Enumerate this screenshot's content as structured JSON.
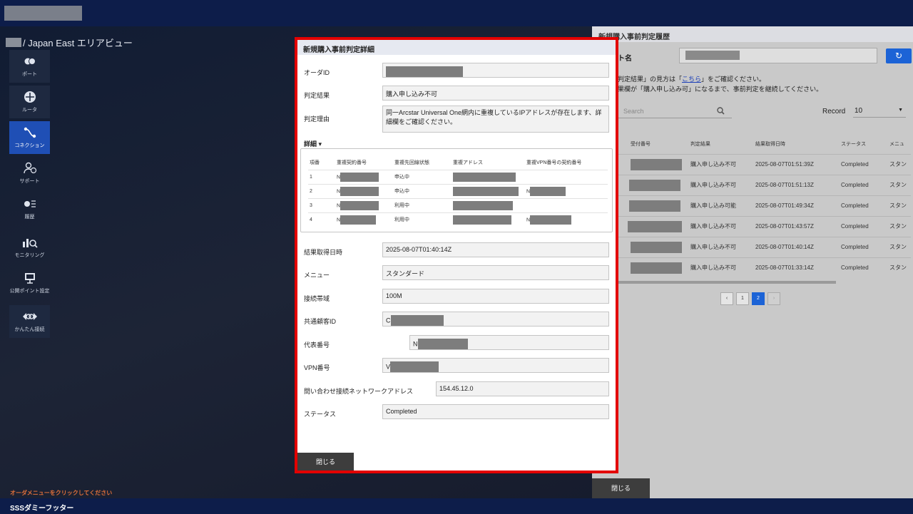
{
  "breadcrumb": {
    "text": "/ Japan East エリアビュー"
  },
  "sidenav": [
    {
      "label": "ポート",
      "icon": "port-icon"
    },
    {
      "label": "ルータ",
      "icon": "router-icon"
    },
    {
      "label": "コネクション",
      "icon": "connection-icon",
      "active": true
    },
    {
      "label": "サポート",
      "icon": "support-icon"
    },
    {
      "label": "履歴",
      "icon": "history-icon"
    },
    {
      "label": "モニタリング",
      "icon": "monitoring-icon"
    },
    {
      "label": "公開ポイント設定",
      "icon": "public-point-icon"
    },
    {
      "label": "かんたん接続",
      "icon": "easy-connect-icon"
    }
  ],
  "hint": "オーダメニューをクリックしてください",
  "footer": "SSSダミーフッター",
  "history": {
    "title": "新規購入事前判定履歴",
    "list_label": "ト名",
    "note1_pre": "判定結果」の見方は「",
    "note1_link": "こちら",
    "note1_post": "」をご確認ください。",
    "note2": "果欄が「購入申し込み可」になるまで、事前判定を継続してください。",
    "search_placeholder": "Search",
    "record_label": "Record",
    "record_value": "10",
    "columns": [
      "受付番号",
      "判定結果",
      "結果取得日時",
      "ステータス",
      "メニュ"
    ],
    "rows": [
      {
        "result": "購入申し込み不可",
        "time": "2025-08-07T01:51:39Z",
        "status": "Completed",
        "menu": "スタン"
      },
      {
        "result": "購入申し込み不可",
        "time": "2025-08-07T01:51:13Z",
        "status": "Completed",
        "menu": "スタン"
      },
      {
        "result": "購入申し込み可能",
        "time": "2025-08-07T01:49:34Z",
        "status": "Completed",
        "menu": "スタン"
      },
      {
        "result": "購入申し込み不可",
        "time": "2025-08-07T01:43:57Z",
        "status": "Completed",
        "menu": "スタン"
      },
      {
        "result": "購入申し込み不可",
        "time": "2025-08-07T01:40:14Z",
        "status": "Completed",
        "menu": "スタン"
      },
      {
        "result": "購入申し込み不可",
        "time": "2025-08-07T01:33:14Z",
        "status": "Completed",
        "menu": "スタン"
      }
    ],
    "pager": {
      "prev": "‹",
      "pages": [
        "1",
        "2"
      ],
      "current": "2",
      "next": "›"
    },
    "close_label": "閉じる"
  },
  "modal": {
    "title": "新規購入事前判定詳細",
    "order_id_label": "オーダID",
    "result_label": "判定結果",
    "result_value": "購入申し込み不可",
    "reason_label": "判定理由",
    "reason_value": "同一Arcstar Universal One網内に重複しているIPアドレスが存在します、詳細欄をご確認ください。",
    "detail_toggle": "詳細 ▾",
    "detail_columns": [
      "項番",
      "重複契約番号",
      "重複先回線状態",
      "重複アドレス",
      "重複VPN番号の契約番号"
    ],
    "detail_rows": [
      {
        "no": "1",
        "contract_prefix": "N",
        "state": "申込中",
        "vpn_prefix": ""
      },
      {
        "no": "2",
        "contract_prefix": "N",
        "state": "申込中",
        "vpn_prefix": "N"
      },
      {
        "no": "3",
        "contract_prefix": "N",
        "state": "利用中",
        "vpn_prefix": ""
      },
      {
        "no": "4",
        "contract_prefix": "N",
        "state": "利用中",
        "vpn_prefix": "N"
      }
    ],
    "time_label": "結果取得日時",
    "time_value": "2025-08-07T01:40:14Z",
    "menu_label": "メニュー",
    "menu_value": "スタンダード",
    "bandwidth_label": "接続帯域",
    "bandwidth_value": "100M",
    "customer_id_label": "共通顧客ID",
    "customer_id_prefix": "C",
    "rep_number_label": "代表番号",
    "rep_number_prefix": "N",
    "vpn_label": "VPN番号",
    "vpn_prefix": "V",
    "network_label": "問い合わせ接続ネットワークアドレス",
    "network_value": "154.45.12.0",
    "status_label": "ステータス",
    "status_value": "Completed",
    "close_label": "閉じる"
  }
}
